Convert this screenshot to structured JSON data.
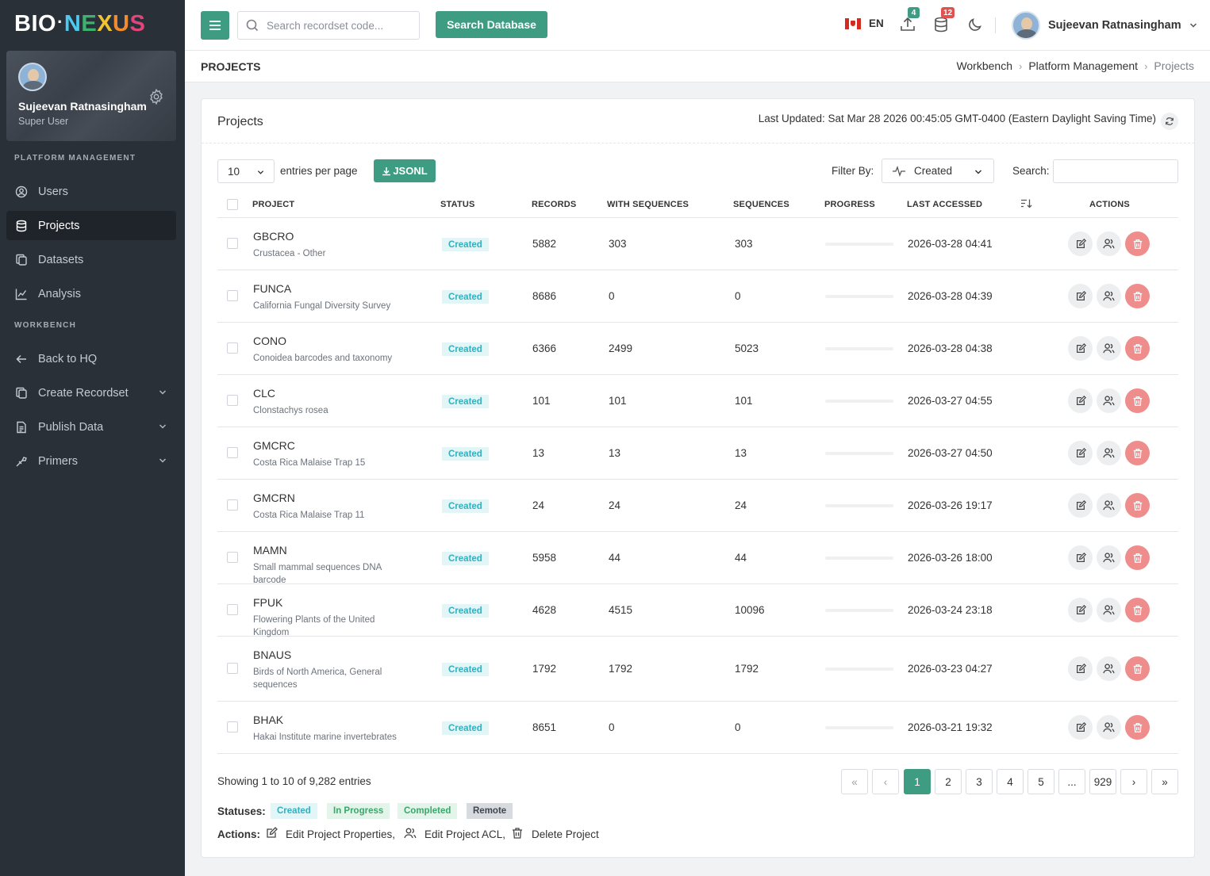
{
  "brand": {
    "part1": "BIO",
    "dot": "·",
    "letters": [
      "N",
      "E",
      "X",
      "U",
      "S"
    ]
  },
  "sidebar": {
    "user_name": "Sujeevan Ratnasingham",
    "user_role": "Super User",
    "section_platform": "PLATFORM MANAGEMENT",
    "section_workbench": "WORKBENCH",
    "items": [
      {
        "label": "Users",
        "icon": "user-circle-icon"
      },
      {
        "label": "Projects",
        "icon": "database-icon"
      },
      {
        "label": "Datasets",
        "icon": "copy-icon"
      },
      {
        "label": "Analysis",
        "icon": "chart-icon"
      },
      {
        "label": "Back to HQ",
        "icon": "arrow-left-icon"
      },
      {
        "label": "Create Recordset",
        "icon": "copy-icon"
      },
      {
        "label": "Publish Data",
        "icon": "document-icon"
      },
      {
        "label": "Primers",
        "icon": "primer-icon"
      }
    ]
  },
  "topbar": {
    "search_placeholder": "Search recordset code...",
    "search_button": "Search Database",
    "language": "EN",
    "upload_badge": "4",
    "database_badge": "12",
    "user_name": "Sujeevan Ratnasingham"
  },
  "page": {
    "title": "PROJECTS",
    "breadcrumbs": [
      "Workbench",
      "Platform Management",
      "Projects"
    ]
  },
  "card": {
    "title": "Projects",
    "last_updated": "Last Updated: Sat Mar 28 2026 00:45:05 GMT-0400 (Eastern Daylight Saving Time)",
    "per_page": "10",
    "per_page_label": "entries per page",
    "jsonl_button": "JSONL",
    "filter_label": "Filter By:",
    "filter_value": "Created",
    "search_label": "Search:"
  },
  "table": {
    "headers": [
      "PROJECT",
      "STATUS",
      "RECORDS",
      "WITH SEQUENCES",
      "SEQUENCES",
      "PROGRESS",
      "LAST ACCESSED",
      "ACTIONS"
    ],
    "rows": [
      {
        "code": "GBCRO",
        "desc": "Crustacea - Other",
        "status": "Created",
        "records": "5882",
        "with_seq": "303",
        "seqs": "303",
        "progress": 0,
        "accessed": "2026-03-28 04:41"
      },
      {
        "code": "FUNCA",
        "desc": "California Fungal Diversity Survey",
        "status": "Created",
        "records": "8686",
        "with_seq": "0",
        "seqs": "0",
        "progress": 0,
        "accessed": "2026-03-28 04:39"
      },
      {
        "code": "CONO",
        "desc": "Conoidea barcodes and taxonomy",
        "status": "Created",
        "records": "6366",
        "with_seq": "2499",
        "seqs": "5023",
        "progress": 0,
        "accessed": "2026-03-28 04:38"
      },
      {
        "code": "CLC",
        "desc": "Clonstachys rosea",
        "status": "Created",
        "records": "101",
        "with_seq": "101",
        "seqs": "101",
        "progress": 0,
        "accessed": "2026-03-27 04:55"
      },
      {
        "code": "GMCRC",
        "desc": "Costa Rica Malaise Trap 15",
        "status": "Created",
        "records": "13",
        "with_seq": "13",
        "seqs": "13",
        "progress": 0,
        "accessed": "2026-03-27 04:50"
      },
      {
        "code": "GMCRN",
        "desc": "Costa Rica Malaise Trap 11",
        "status": "Created",
        "records": "24",
        "with_seq": "24",
        "seqs": "24",
        "progress": 0,
        "accessed": "2026-03-26 19:17"
      },
      {
        "code": "MAMN",
        "desc": "Small mammal sequences DNA barcode",
        "status": "Created",
        "records": "5958",
        "with_seq": "44",
        "seqs": "44",
        "progress": 0,
        "accessed": "2026-03-26 18:00"
      },
      {
        "code": "FPUK",
        "desc": "Flowering Plants of the United Kingdom",
        "status": "Created",
        "records": "4628",
        "with_seq": "4515",
        "seqs": "10096",
        "progress": 0,
        "accessed": "2026-03-24 23:18"
      },
      {
        "code": "BNAUS",
        "desc": "Birds of North America, General sequences",
        "status": "Created",
        "records": "1792",
        "with_seq": "1792",
        "seqs": "1792",
        "progress": 0,
        "accessed": "2026-03-23 04:27"
      },
      {
        "code": "BHAK",
        "desc": "Hakai Institute marine invertebrates",
        "status": "Created",
        "records": "8651",
        "with_seq": "0",
        "seqs": "0",
        "progress": 0,
        "accessed": "2026-03-21 19:32"
      }
    ]
  },
  "footer": {
    "showing": "Showing 1 to 10 of 9,282 entries",
    "pages": [
      "«",
      "‹",
      "1",
      "2",
      "3",
      "4",
      "5",
      "...",
      "929",
      "›",
      "»"
    ],
    "active_page": "1",
    "statuses_label": "Statuses:",
    "statuses": [
      {
        "label": "Created",
        "bg": "#e2f5f7",
        "fg": "#36aebd"
      },
      {
        "label": "In Progress",
        "bg": "#e3f4ea",
        "fg": "#3ba76a"
      },
      {
        "label": "Completed",
        "bg": "#e3f4ea",
        "fg": "#3ba76a"
      },
      {
        "label": "Remote",
        "bg": "#d7dadf",
        "fg": "#3f454d"
      }
    ],
    "actions_label": "Actions:",
    "action_edit": "Edit Project Properties,",
    "action_acl": "Edit Project ACL,",
    "action_delete": "Delete Project"
  },
  "colors": {
    "accent": "#3d9c82",
    "sidebar": "#2a3038",
    "danger": "#ef8d8d"
  }
}
